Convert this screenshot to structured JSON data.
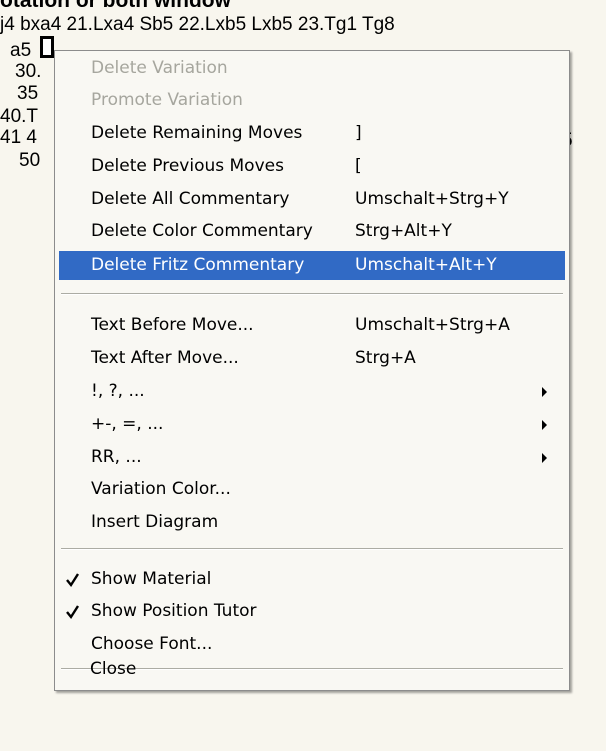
{
  "heading": "otation or both window",
  "moves": {
    "line0": "j4  bxa4  21.Lxa4  Sb5  22.Lxb5  Lxb5  23.Tg1  Tg8",
    "line1_pre": "a5",
    "line2": "30.",
    "line3": "35",
    "line4": "40.T",
    "line5": "41 4",
    "line6": "50",
    "right_fragment": "5"
  },
  "menu": {
    "items": [
      {
        "label": "Delete Variation",
        "shortcut": "",
        "disabled": true
      },
      {
        "label": "Promote Variation",
        "shortcut": "",
        "disabled": true
      },
      {
        "label": "Delete Remaining Moves",
        "shortcut": "]"
      },
      {
        "label": "Delete Previous Moves",
        "shortcut": "["
      },
      {
        "label": "Delete All Commentary",
        "shortcut": "Umschalt+Strg+Y"
      },
      {
        "label": "Delete Color Commentary",
        "shortcut": "Strg+Alt+Y"
      },
      {
        "label": "Delete Fritz Commentary",
        "shortcut": "Umschalt+Alt+Y",
        "highlighted": true
      },
      {
        "label": "Text Before Move...",
        "shortcut": "Umschalt+Strg+A"
      },
      {
        "label": "Text After Move...",
        "shortcut": "Strg+A"
      },
      {
        "label": "!, ?, ...",
        "submenu": true
      },
      {
        "label": "+-, =, ...",
        "submenu": true
      },
      {
        "label": "RR, ...",
        "submenu": true
      },
      {
        "label": "Variation Color..."
      },
      {
        "label": "Insert Diagram"
      },
      {
        "label": "Show Material",
        "checked": true
      },
      {
        "label": "Show Position Tutor",
        "checked": true
      },
      {
        "label": "Choose Font..."
      },
      {
        "label": "Close"
      }
    ]
  },
  "colors": {
    "highlight": "#316ac5",
    "disabled_text": "#a6a69e",
    "menu_background": "#f9f8f3"
  }
}
